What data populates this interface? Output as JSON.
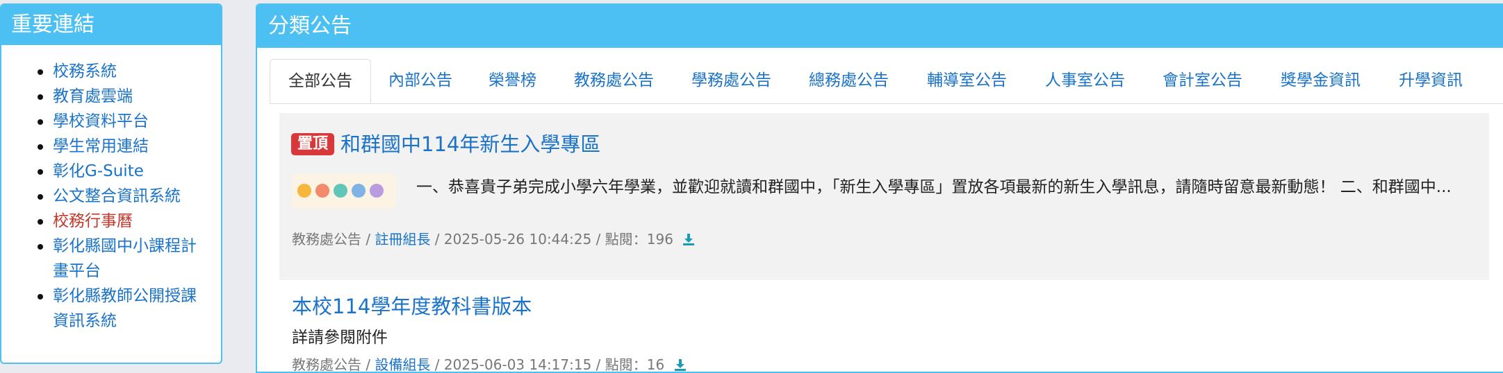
{
  "links_panel": {
    "title": "重要連結",
    "items": [
      {
        "label": "校務系統"
      },
      {
        "label": "教育處雲端"
      },
      {
        "label": "學校資料平台"
      },
      {
        "label": "學生常用連結"
      },
      {
        "label": "彰化G-Suite"
      },
      {
        "label": "公文整合資訊系統"
      },
      {
        "label": "校務行事曆"
      },
      {
        "label": "彰化縣國中小課程計畫平台"
      },
      {
        "label": "彰化縣教師公開授課資訊系統"
      }
    ]
  },
  "main_panel": {
    "title": "分類公告",
    "tabs": [
      {
        "label": "全部公告"
      },
      {
        "label": "內部公告"
      },
      {
        "label": "榮譽榜"
      },
      {
        "label": "教務處公告"
      },
      {
        "label": "學務處公告"
      },
      {
        "label": "總務處公告"
      },
      {
        "label": "輔導室公告"
      },
      {
        "label": "人事室公告"
      },
      {
        "label": "會計室公告"
      },
      {
        "label": "獎學金資訊"
      },
      {
        "label": "升學資訊"
      }
    ],
    "posts": [
      {
        "badge": "置頂",
        "title": "和群國中114年新生入學專區",
        "summary": "一、恭喜貴子弟完成小學六年學業，並歡迎就讀和群國中，「新生入學專區」置放各項最新的新生入學訊息，請隨時留意最新動態！ 二、和群國中...",
        "category": "教務處公告",
        "sep1": " / ",
        "author": "註冊組長",
        "rest": " / 2025-05-26 10:44:25 / 點閱：196"
      },
      {
        "title": "本校114學年度教科書版本",
        "body": "詳請參閱附件",
        "category": "教務處公告",
        "sep1": " / ",
        "author": "設備組長",
        "rest": " / 2025-06-03 14:17:15 / 點閱：16"
      }
    ]
  },
  "colors": {
    "header": "#4cc0f2",
    "link": "#1a73c9",
    "active_link": "#c0392b",
    "badge": "#d9383a",
    "download_icon": "#1a9bb5"
  },
  "icons": [
    "download-icon"
  ]
}
